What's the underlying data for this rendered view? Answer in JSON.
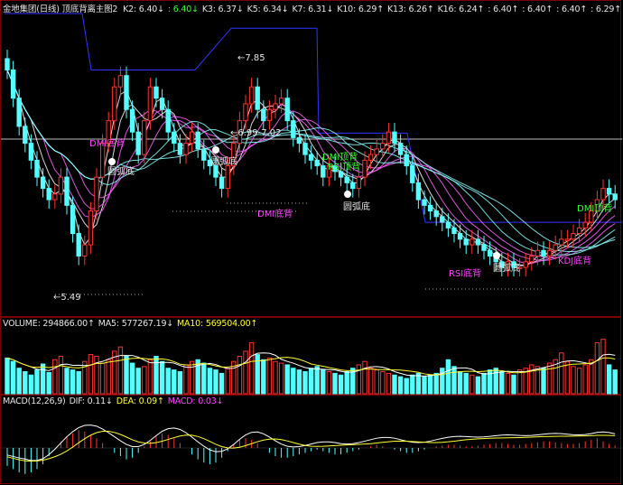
{
  "colors": {
    "up": "#ff3333",
    "down": "#55ffff",
    "ma_top": "#ffffff",
    "ma_pink": "#ff66ff",
    "ma_cyan": "#88ffff",
    "envelope": "#3333ff",
    "grid": "#7a0000"
  },
  "price_header": {
    "title": "金地集团(日线) 顶底背离主图2",
    "items": [
      {
        "text": "K2: 6.40",
        "arrow": "↓",
        "color": "#e6e6e6"
      },
      {
        "text": ": 6.40",
        "arrow": "↓",
        "color": "#33ff33"
      },
      {
        "text": "K3: 6.37",
        "arrow": "↓",
        "color": "#e6e6e6"
      },
      {
        "text": "K5: 6.34",
        "arrow": "↓",
        "color": "#e6e6e6"
      },
      {
        "text": "K7: 6.31",
        "arrow": "↓",
        "color": "#e6e6e6"
      },
      {
        "text": "K10: 6.29",
        "arrow": "↑",
        "color": "#e6e6e6"
      },
      {
        "text": "K13: 6.26",
        "arrow": "↑",
        "color": "#e6e6e6"
      },
      {
        "text": "K16: 6.24",
        "arrow": "↑",
        "color": "#e6e6e6"
      },
      {
        "text": ": 6.40",
        "arrow": "↑",
        "color": "#e6e6e6"
      },
      {
        "text": ": 6.40",
        "arrow": "↑",
        "color": "#e6e6e6"
      },
      {
        "text": ": 6.40",
        "arrow": "↑",
        "color": "#e6e6e6"
      },
      {
        "text": ": 6.29",
        "arrow": "↑",
        "color": "#e6e6e6"
      }
    ]
  },
  "price_labels": {
    "high": "7.85",
    "mid": "6.99-7.02",
    "low": "5.49",
    "signals": [
      "圆弧底",
      "圆弧底",
      "圆弧底",
      "圆弧底",
      "DMI底背",
      "DMI底背",
      "DMI顶背",
      "RSI顶背",
      "RSI底背",
      "KDJ底背",
      "DMI顶背"
    ]
  },
  "volume_header": [
    {
      "text": "VOLUME: 294866.00",
      "arrow": "↑",
      "color": "#e6e6e6"
    },
    {
      "text": "MA5: 577267.19",
      "arrow": "↓",
      "color": "#e6e6e6"
    },
    {
      "text": "MA10: 569504.00",
      "arrow": "↑",
      "color": "#ffff33"
    }
  ],
  "macd_header": [
    {
      "text": "MACD(12,26,9)",
      "arrow": "",
      "color": "#e6e6e6"
    },
    {
      "text": "DIF: 0.11",
      "arrow": "↓",
      "color": "#e6e6e6"
    },
    {
      "text": "DEA: 0.09",
      "arrow": "↑",
      "color": "#ffff33"
    },
    {
      "text": "MACD: 0.03",
      "arrow": "↓",
      "color": "#ff44ff"
    }
  ],
  "chart_data": {
    "type": "candlestick",
    "closes": [
      7.55,
      7.3,
      7.05,
      6.9,
      6.75,
      6.6,
      6.5,
      6.4,
      6.45,
      6.6,
      6.35,
      6.1,
      5.9,
      6.0,
      6.3,
      6.6,
      6.9,
      7.1,
      7.4,
      7.5,
      7.2,
      7.0,
      6.8,
      7.1,
      7.4,
      7.3,
      7.2,
      7.0,
      6.9,
      6.8,
      6.9,
      7.0,
      6.85,
      6.75,
      6.7,
      6.6,
      6.5,
      6.7,
      6.9,
      7.1,
      7.25,
      7.4,
      7.2,
      7.1,
      7.2,
      7.25,
      7.3,
      7.1,
      6.95,
      6.9,
      6.8,
      6.75,
      6.7,
      6.6,
      6.7,
      6.65,
      6.6,
      6.55,
      6.5,
      6.6,
      6.75,
      6.8,
      6.85,
      6.9,
      7.0,
      6.9,
      6.8,
      6.7,
      6.55,
      6.4,
      6.35,
      6.3,
      6.25,
      6.2,
      6.15,
      6.1,
      6.05,
      6.0,
      6.05,
      6.0,
      5.95,
      5.9,
      5.85,
      5.8,
      5.85,
      5.8,
      5.8,
      5.85,
      5.9,
      5.95,
      5.9,
      5.95,
      6.0,
      6.05,
      6.05,
      6.1,
      6.15,
      6.2,
      6.3,
      6.4,
      6.5,
      6.45,
      6.4
    ],
    "volumes": [
      42,
      38,
      30,
      26,
      22,
      28,
      35,
      25,
      40,
      44,
      30,
      28,
      26,
      38,
      46,
      44,
      36,
      40,
      50,
      55,
      44,
      36,
      30,
      32,
      40,
      44,
      38,
      30,
      28,
      26,
      34,
      38,
      40,
      36,
      30,
      28,
      24,
      30,
      38,
      44,
      50,
      60,
      46,
      40,
      42,
      38,
      36,
      34,
      30,
      28,
      26,
      30,
      32,
      28,
      26,
      24,
      22,
      26,
      30,
      34,
      38,
      30,
      28,
      26,
      24,
      22,
      20,
      18,
      22,
      24,
      20,
      22,
      24,
      30,
      40,
      32,
      26,
      24,
      22,
      20,
      24,
      28,
      30,
      26,
      24,
      22,
      28,
      30,
      34,
      32,
      30,
      36,
      40,
      48,
      38,
      32,
      30,
      34,
      40,
      60,
      64,
      34,
      28
    ],
    "macd": [
      -0.22,
      -0.26,
      -0.3,
      -0.32,
      -0.3,
      -0.26,
      -0.2,
      -0.1,
      0.0,
      0.08,
      0.14,
      0.18,
      0.22,
      0.2,
      0.16,
      0.12,
      0.06,
      0.0,
      -0.06,
      -0.1,
      -0.14,
      -0.12,
      -0.06,
      0.02,
      0.08,
      0.14,
      0.18,
      0.16,
      0.12,
      0.06,
      0.0,
      -0.08,
      -0.14,
      -0.18,
      -0.2,
      -0.18,
      -0.12,
      -0.04,
      0.04,
      0.1,
      0.12,
      0.1,
      0.06,
      0.0,
      -0.06,
      -0.1,
      -0.12,
      -0.12,
      -0.1,
      -0.08,
      -0.06,
      -0.04,
      -0.02,
      -0.04,
      -0.06,
      -0.08,
      -0.08,
      -0.06,
      -0.04,
      -0.02,
      0.0,
      0.02,
      0.04,
      0.02,
      0.0,
      -0.02,
      -0.04,
      -0.06,
      -0.06,
      -0.04,
      -0.02,
      0.0,
      0.02,
      0.03,
      0.04,
      0.04,
      0.03,
      0.02,
      0.02,
      0.03,
      0.04,
      0.05,
      0.06,
      0.06,
      0.05,
      0.04,
      0.04,
      0.05,
      0.06,
      0.07,
      0.08,
      0.08,
      0.07,
      0.06,
      0.05,
      0.05,
      0.06,
      0.08,
      0.1,
      0.12,
      0.08,
      0.05,
      0.03
    ],
    "ylim": [
      5.4,
      8.05
    ]
  }
}
